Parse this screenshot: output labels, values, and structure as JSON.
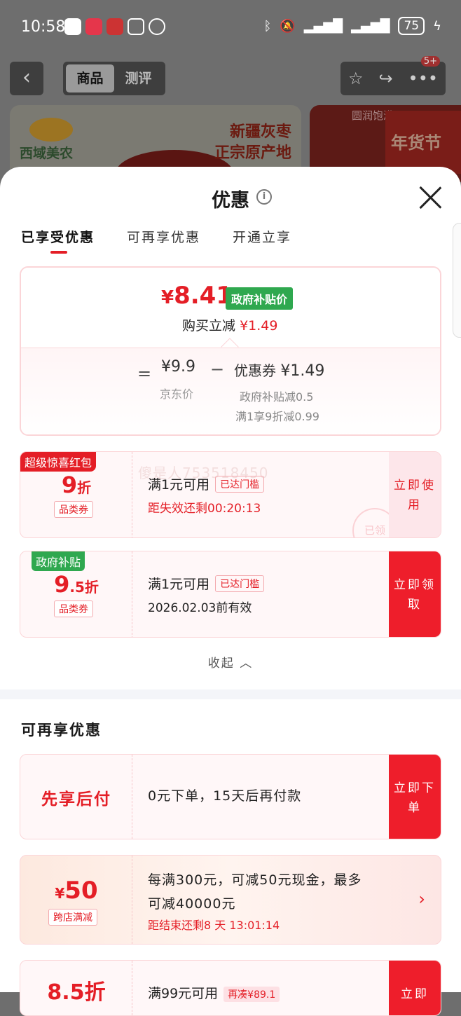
{
  "status_bar": {
    "time": "10:58",
    "battery": "75"
  },
  "nav": {
    "tab_product": "商品",
    "tab_review": "测评",
    "badge": "5+"
  },
  "banner": {
    "brand": "西域美农",
    "line1": "新疆灰枣",
    "line2": "正宗原产地",
    "side_title": "圆润饱满",
    "side_promo": "年货节"
  },
  "sheet": {
    "title": "优惠",
    "tabs": [
      "已享受优惠",
      "可再享优惠",
      "开通立享"
    ],
    "summary": {
      "price_symbol": "¥",
      "price": "8.41",
      "gov_tag": "政府补贴价",
      "instant_label": "购买立减",
      "instant_value": "¥1.49",
      "equals": "=",
      "jd_price": "¥9.9",
      "jd_label": "京东价",
      "minus": "−",
      "coupon_label": "优惠券",
      "coupon_value": "¥1.49",
      "detail1": "政府补贴减0.5",
      "detail2": "满1享9折减0.99"
    },
    "coupons": [
      {
        "tag": "超级惊喜红包",
        "value": "9",
        "unit": "折",
        "kind": "品类券",
        "cond": "满1元可用",
        "reached": "已达门槛",
        "sub": "距失效还剩00:20:13",
        "btn": "立即使用",
        "watermark": "傻是人753518450",
        "stamp": "已领"
      },
      {
        "tag": "政府补贴",
        "value": "9",
        "unit": ".5折",
        "kind": "品类券",
        "cond": "满1元可用",
        "reached": "已达门槛",
        "sub": "2026.02.03前有效",
        "btn": "立即领取"
      }
    ],
    "collapse": "收起 ︿",
    "section_title": "可再享优惠",
    "offers": [
      {
        "left": "先享后付",
        "text": "0元下单，15天后再付款",
        "btn": "立即下单"
      },
      {
        "symbol": "¥",
        "amount": "50",
        "kind": "跨店满减",
        "line1": "每满300元，可减50元现金，最多",
        "line2": "可减40000元",
        "line3": "距结束还剩8 天 13:01:14",
        "chevron": "›"
      },
      {
        "amount": "8.5折",
        "cond": "满99元可用",
        "reached": "再凑¥89.1",
        "btn": "立即"
      }
    ]
  }
}
